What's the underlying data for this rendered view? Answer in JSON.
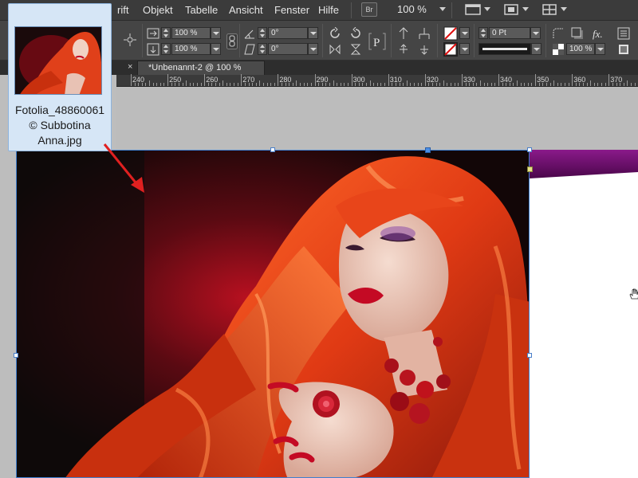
{
  "menubar": {
    "items": [
      "rift",
      "Objekt",
      "Tabelle",
      "Ansicht",
      "Fenster",
      "Hilfe"
    ],
    "bridge_label": "Br",
    "zoom": "100 %"
  },
  "controls": {
    "scale_x": "100 %",
    "scale_y": "100 %",
    "rotation": "0°",
    "shear": "0°",
    "stroke_weight": "0 Pt",
    "opacity": "100 %"
  },
  "tab": {
    "close": "×",
    "title": "*Unbenannt-2 @ 100 %"
  },
  "ruler": {
    "labels": [
      "240",
      "250",
      "260",
      "270",
      "280",
      "290",
      "300",
      "310",
      "320",
      "330",
      "340",
      "350",
      "360",
      "370"
    ]
  },
  "drag_preview": {
    "caption_line1": "Fotolia_48860061",
    "caption_line2": "© Subbotina",
    "caption_line3": "Anna.jpg"
  },
  "colors": {
    "selection": "#3f7fd0",
    "arrow": "#e02020",
    "purple": "#6a0f6a"
  }
}
